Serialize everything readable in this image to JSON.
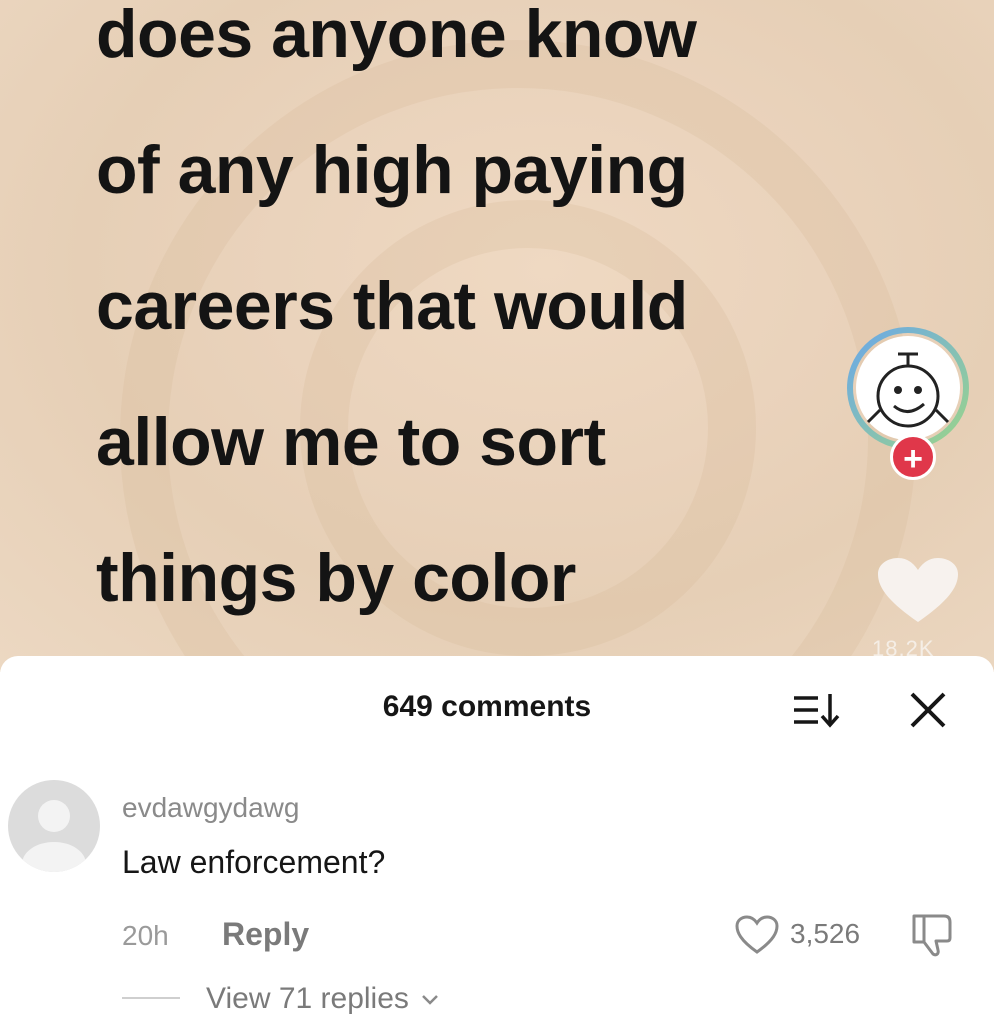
{
  "video": {
    "caption_lines": [
      "does anyone know",
      "of any high paying",
      "careers that would",
      "allow me to sort",
      "things by color"
    ],
    "like_count": "18.2K",
    "follow_symbol": "+"
  },
  "comments_panel": {
    "count_label": "649 comments",
    "comment": {
      "username": "evdawgydawg",
      "text": "Law enforcement?",
      "time": "20h",
      "reply_label": "Reply",
      "like_count": "3,526",
      "view_replies_label": "View 71 replies"
    }
  },
  "icons": {
    "sort": "sort-icon",
    "close": "close-icon",
    "heart": "heart-icon",
    "dislike": "dislike-icon",
    "chevron": "chevron-down-icon"
  },
  "colors": {
    "follow": "#e0374a",
    "video_bg": "#ead3bc"
  }
}
